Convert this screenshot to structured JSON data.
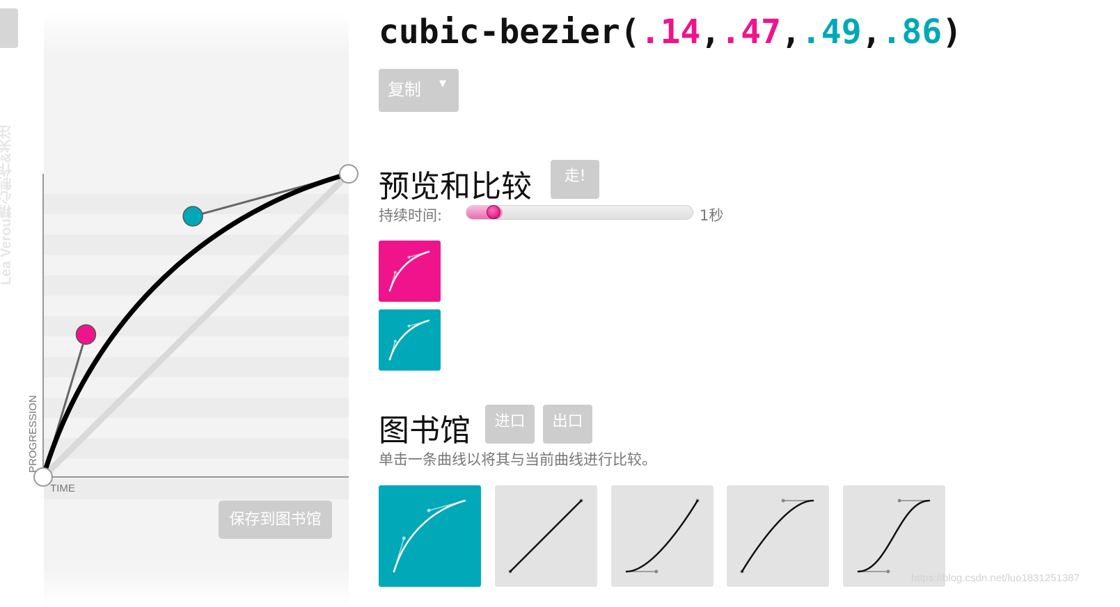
{
  "ribbon": {
    "text": "Lea Verou精心制作&关注"
  },
  "bezier": {
    "p1": [
      0.14,
      0.47
    ],
    "p2": [
      0.49,
      0.86
    ],
    "p1_color": "#f0148c",
    "p2_color": "#00a8b8",
    "axis_x_label": "TIME",
    "axis_y_label": "PROGRESSION"
  },
  "header": {
    "prefix": "cubic-bezier(",
    "v1": ".14",
    "sep1": ",",
    "v2": ".47",
    "sep2": ",",
    "v3": ".49",
    "sep3": ",",
    "v4": ".86",
    "suffix": ")"
  },
  "copy_button": {
    "label": "复制",
    "arrow": "▼"
  },
  "save_button": {
    "label": "保存到图书馆"
  },
  "preview": {
    "title": "预览和比较",
    "go_label": "走!",
    "duration_label": "持续时间:",
    "duration_value": "1秒",
    "duration_fraction": 0.12,
    "boxes": [
      {
        "color": "#f0148c",
        "curve": [
          0.14,
          0.47,
          0.49,
          0.86
        ]
      },
      {
        "color": "#00a8b8",
        "curve": [
          0.14,
          0.47,
          0.49,
          0.86
        ]
      }
    ]
  },
  "library": {
    "title": "图书馆",
    "import_label": "进口",
    "export_label": "出口",
    "description": "单击一条曲线以将其与当前曲线进行比较。",
    "items": [
      {
        "active": true,
        "curve": [
          0.14,
          0.47,
          0.49,
          0.86
        ]
      },
      {
        "active": false,
        "curve": [
          0,
          0,
          1,
          1
        ]
      },
      {
        "active": false,
        "curve": [
          0.42,
          0,
          1,
          1
        ]
      },
      {
        "active": false,
        "curve": [
          0,
          0,
          0.58,
          1
        ]
      },
      {
        "active": false,
        "curve": [
          0.42,
          0,
          0.58,
          1
        ]
      }
    ]
  },
  "watermark": "https://blog.csdn.net/luo1831251387"
}
